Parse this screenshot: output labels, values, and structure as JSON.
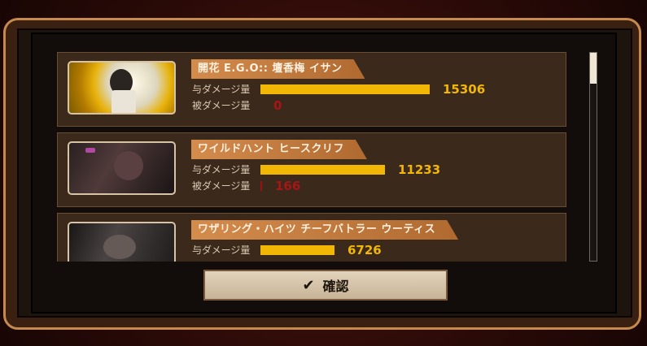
{
  "results": [
    {
      "name": "開花 E.G.O:: 壇香梅 イサン",
      "damage_dealt_label": "与ダメージ量",
      "damage_taken_label": "被ダメージ量",
      "damage_dealt": "15306",
      "damage_taken": "0",
      "dealt_fraction": 1.0,
      "taken_fraction": 0.0,
      "portrait": "isangs-ego-portrait"
    },
    {
      "name": "ワイルドハント ヒースクリフ",
      "damage_dealt_label": "与ダメージ量",
      "damage_taken_label": "被ダメージ量",
      "damage_dealt": "11233",
      "damage_taken": "166",
      "dealt_fraction": 0.734,
      "taken_fraction": 0.011,
      "portrait": "heathcliff-portrait"
    },
    {
      "name": "ワザリング・ハイツ チーフバトラー ウーティス",
      "damage_dealt_label": "与ダメージ量",
      "damage_taken_label": "被ダメージ量",
      "damage_dealt": "6726",
      "damage_taken": "",
      "dealt_fraction": 0.439,
      "taken_fraction": 0.0,
      "portrait": "outis-portrait"
    }
  ],
  "confirm_button": {
    "label": "確認",
    "icon": "check-icon"
  },
  "colors": {
    "dealt_bar": "#f2b705",
    "taken_bar": "#a01010",
    "name_tag": "#c47a3c"
  }
}
